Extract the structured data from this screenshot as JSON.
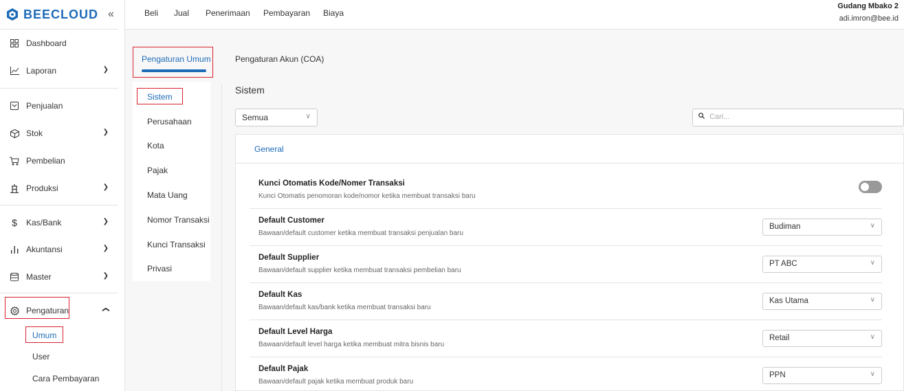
{
  "app": {
    "brand": "BEECLOUD",
    "accent": "#1e6bb8",
    "highlight": "#d9232d"
  },
  "sidebar": {
    "items": [
      {
        "label": "Dashboard",
        "icon": "grid-icon"
      },
      {
        "label": "Laporan",
        "icon": "chart-line-icon",
        "chevron": "down"
      },
      {
        "label": "Penjualan",
        "icon": "sales-icon"
      },
      {
        "label": "Stok",
        "icon": "box-icon",
        "chevron": "down"
      },
      {
        "label": "Pembelian",
        "icon": "cart-icon"
      },
      {
        "label": "Produksi",
        "icon": "factory-icon",
        "chevron": "down"
      },
      {
        "label": "Kas/Bank",
        "icon": "dollar-icon",
        "chevron": "down"
      },
      {
        "label": "Akuntansi",
        "icon": "bar-chart-icon",
        "chevron": "down"
      },
      {
        "label": "Master",
        "icon": "database-icon",
        "chevron": "down"
      },
      {
        "label": "Pengaturan",
        "icon": "gear-icon",
        "chevron": "up"
      }
    ],
    "subitems": [
      "Umum",
      "User",
      "Cara Pembayaran"
    ]
  },
  "topnav": [
    "Beli",
    "Jual",
    "Penerimaan",
    "Pembayaran",
    "Biaya"
  ],
  "user": {
    "name": "Gudang Mbako 2",
    "email": "adi.imron@bee.id"
  },
  "tabs": [
    "Pengaturan Umum",
    "Pengaturan Akun (COA)"
  ],
  "leftnav": [
    "Sistem",
    "Perusahaan",
    "Kota",
    "Pajak",
    "Mata Uang",
    "Nomor Transaksi",
    "Kunci Transaksi",
    "Privasi"
  ],
  "section": {
    "title": "Sistem",
    "filter_value": "Semua",
    "search_placeholder": "Cari...",
    "group": "General"
  },
  "settings": [
    {
      "title": "Kunci Otomatis Kode/Nomer Transaksi",
      "desc": "Kunci Otomatis penomoran kode/nomor ketika membuat transaksi baru",
      "toggle": false
    },
    {
      "title": "Default Customer",
      "desc": "Bawaan/default customer ketika membuat transaksi penjualan baru",
      "value": "Budiman"
    },
    {
      "title": "Default Supplier",
      "desc": "Bawaan/default supplier ketika membuat transaksi pembelian baru",
      "value": "PT ABC"
    },
    {
      "title": "Default Kas",
      "desc": "Bawaan/default kas/bank ketika membuat transaksi baru",
      "value": "Kas Utama"
    },
    {
      "title": "Default Level Harga",
      "desc": "Bawaan/default level harga ketika membuat mitra bisnis baru",
      "value": "Retail"
    },
    {
      "title": "Default Pajak",
      "desc": "Bawaan/default pajak ketika membuat produk baru",
      "value": "PPN"
    }
  ]
}
